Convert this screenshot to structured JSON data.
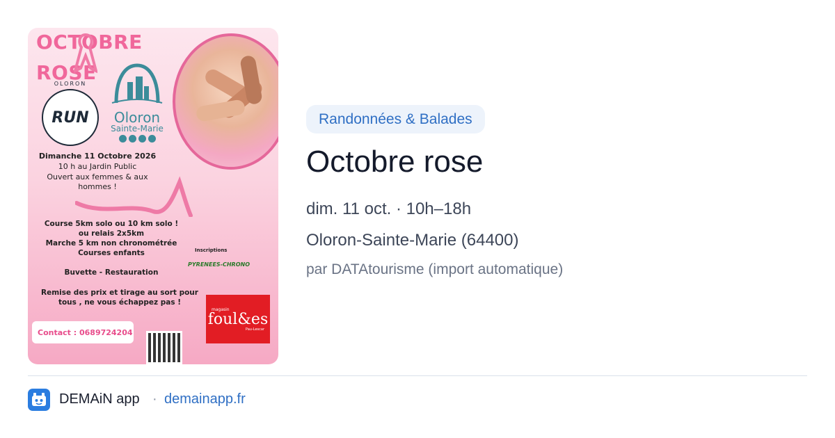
{
  "poster": {
    "title_line1": "OCTOBRE",
    "title_line2": "ROSE",
    "run_club_arc": "OLORON",
    "run_club_word": "RUN",
    "town_name": "Oloron",
    "town_sub": "Sainte-Marie",
    "date_line": "Dimanche 11 Octobre 2026",
    "time_place": "10 h au Jardin Public",
    "open_line1": "Ouvert aux femmes & aux",
    "open_line2": "hommes !",
    "course_line1": "Course 5km solo ou 10 km solo !",
    "course_line2": "ou relais 2x5km",
    "course_line3": "Marche 5 km non chronométrée",
    "course_line4": "Courses enfants",
    "inscriptions_label": "Inscriptions",
    "chrono_brand": "PYRENEES-CHRONO",
    "buvette": "Buvette - Restauration",
    "prize_line1": "Remise des prix et tirage au sort pour",
    "prize_line2": "tous , ne vous échappez pas  !",
    "contact": "Contact : 0689724204",
    "sponsor_top": "magasin",
    "sponsor_name": "foul&es",
    "sponsor_bottom": "Pau-Lescar",
    "accent_pink": "#f0679b",
    "sponsor_red": "#e21d24"
  },
  "card": {
    "category_tag": "Randonnées & Balades",
    "title": "Octobre rose",
    "date_time": "dim. 11 oct. · 10h–18h",
    "location": "Oloron-Sainte-Marie (64400)",
    "source": "par DATAtourisme (import automatique)"
  },
  "footer": {
    "app_icon": "demain-app-icon",
    "app_name": "DEMAiN app",
    "separator": "·",
    "url": "demainapp.fr",
    "accent_color": "#2f6fc4"
  }
}
